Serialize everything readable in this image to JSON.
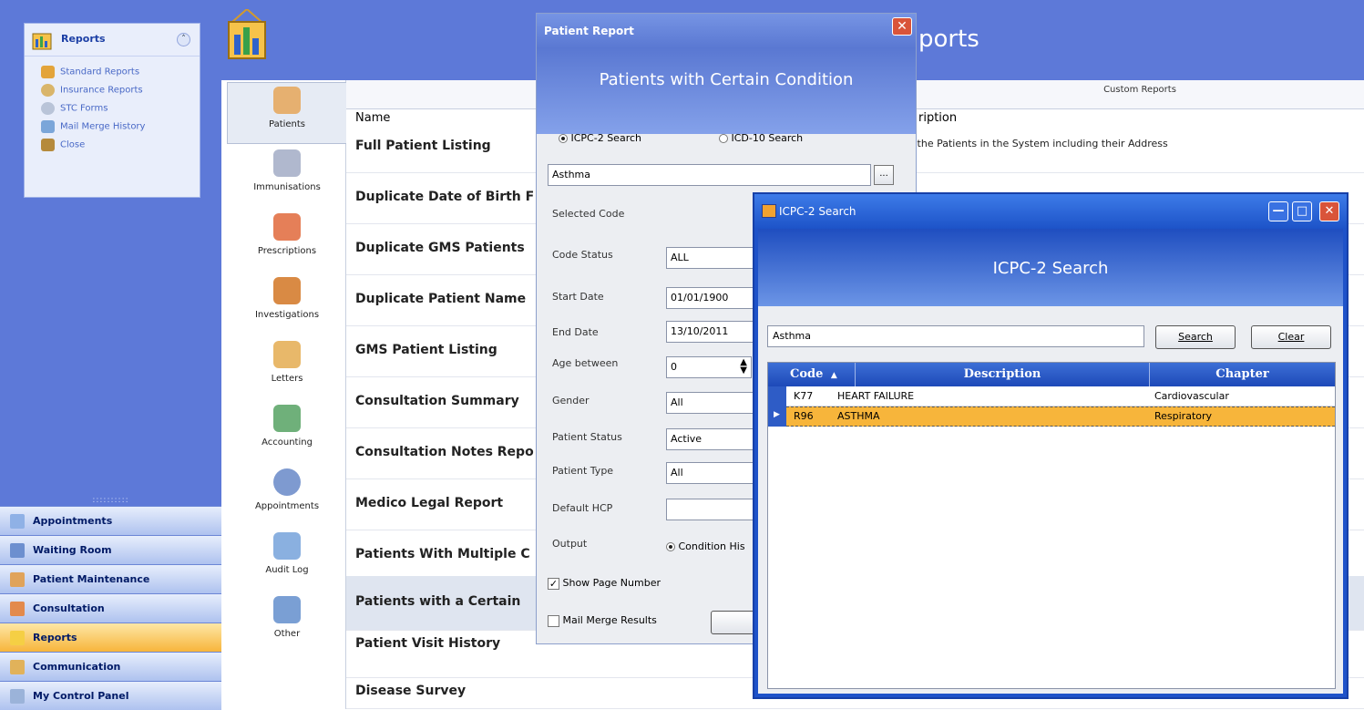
{
  "left_pane": {
    "group_title": "Reports",
    "group_items": [
      {
        "label": "Standard Reports",
        "icon": "standard-reports-icon"
      },
      {
        "label": "Insurance Reports",
        "icon": "insurance-reports-icon"
      },
      {
        "label": "STC Forms",
        "icon": "stc-forms-icon"
      },
      {
        "label": "Mail Merge History",
        "icon": "mail-merge-icon"
      },
      {
        "label": "Close",
        "icon": "close-icon"
      }
    ],
    "nav_buttons": [
      {
        "label": "Appointments",
        "icon": "calendar-icon"
      },
      {
        "label": "Waiting Room",
        "icon": "waiting-room-icon"
      },
      {
        "label": "Patient Maintenance",
        "icon": "patients-icon"
      },
      {
        "label": "Consultation",
        "icon": "consultation-icon"
      },
      {
        "label": "Reports",
        "icon": "reports-icon",
        "active": true
      },
      {
        "label": "Communication",
        "icon": "communication-icon"
      },
      {
        "label": "My Control Panel",
        "icon": "control-panel-icon"
      }
    ]
  },
  "main": {
    "title_visible": "ports",
    "icon_column": [
      {
        "label": "Patients",
        "icon": "patients-icon",
        "selected": true
      },
      {
        "label": "Immunisations",
        "icon": "syringe-icon"
      },
      {
        "label": "Prescriptions",
        "icon": "prescription-icon"
      },
      {
        "label": "Investigations",
        "icon": "investigations-icon"
      },
      {
        "label": "Letters",
        "icon": "letters-icon"
      },
      {
        "label": "Accounting",
        "icon": "accounting-icon"
      },
      {
        "label": "Appointments",
        "icon": "appointments-icon"
      },
      {
        "label": "Audit Log",
        "icon": "audit-log-icon"
      },
      {
        "label": "Other",
        "icon": "other-icon"
      }
    ],
    "grid": {
      "custom_reports_header": "Custom Reports",
      "col_name": "Name",
      "col_desc": "ription",
      "rows": [
        {
          "name": "Full Patient Listing",
          "desc": "l the Patients in the System including their Address"
        },
        {
          "name": "Duplicate Date of Birth F",
          "desc": ""
        },
        {
          "name": "Duplicate GMS Patients",
          "desc": ""
        },
        {
          "name": "Duplicate Patient Name",
          "desc": ""
        },
        {
          "name": "GMS Patient Listing",
          "desc": ""
        },
        {
          "name": "Consultation Summary",
          "desc": ""
        },
        {
          "name": "Consultation Notes Repo",
          "desc": ""
        },
        {
          "name": "Medico Legal Report",
          "desc": ""
        },
        {
          "name": "Patients With Multiple C",
          "desc": ""
        },
        {
          "name": "Patients with a Certain",
          "desc": "",
          "highlighted": true
        },
        {
          "name": "Patient Visit History",
          "desc": ""
        },
        {
          "name": "Disease Survey",
          "desc": ""
        }
      ]
    }
  },
  "patient_dialog": {
    "title": "Patient Report",
    "banner": "Patients with Certain Condition",
    "radio_icpc": "ICPC-2 Search",
    "radio_icd": "ICD-10 Search",
    "condition_value": "Asthma",
    "browse_label": "...",
    "labels": {
      "selected_code": "Selected Code",
      "code_status": "Code Status",
      "start_date": "Start Date",
      "end_date": "End Date",
      "age_between": "Age between",
      "gender": "Gender",
      "patient_status": "Patient Status",
      "patient_type": "Patient Type",
      "default_hcp": "Default HCP",
      "output": "Output"
    },
    "values": {
      "code_status": "ALL",
      "start_date": "01/01/1900",
      "end_date": "13/10/2011",
      "age_from": "0",
      "gender": "All",
      "patient_status": "Active",
      "patient_type": "All",
      "default_hcp": ""
    },
    "output_option": "Condition His",
    "show_page_number": "Show Page Number",
    "mail_merge_results": "Mail Merge Results"
  },
  "icpc_dialog": {
    "title": "ICPC-2 Search",
    "banner": "ICPC-2 Search",
    "search_value": "Asthma",
    "search_button": "Search",
    "clear_button": "Clear",
    "columns": {
      "code": "Code",
      "description": "Description",
      "chapter": "Chapter"
    },
    "rows": [
      {
        "code": "K77",
        "description": "HEART FAILURE",
        "chapter": "Cardiovascular"
      },
      {
        "code": "R96",
        "description": "ASTHMA",
        "chapter": "Respiratory",
        "selected": true
      }
    ]
  }
}
